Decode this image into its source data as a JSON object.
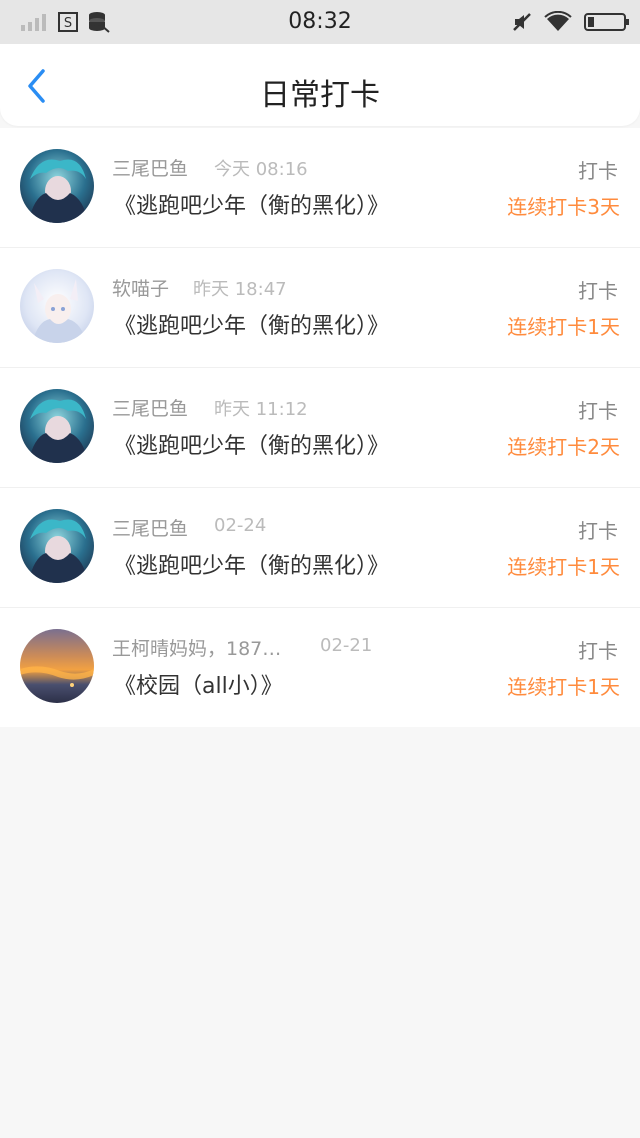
{
  "status_bar": {
    "time": "08:32",
    "signal_icon": "signal-bars-icon",
    "sim_icon": "sim-s-icon",
    "data_icon": "data-saver-icon",
    "mute_icon": "mute-icon",
    "wifi_icon": "wifi-icon",
    "battery_icon": "battery-icon"
  },
  "header": {
    "title": "日常打卡",
    "back_icon": "chevron-left-icon",
    "accent": "#2a8df3"
  },
  "colors": {
    "streak": "#ff8b3d",
    "background": "#f7f7f7"
  },
  "records": [
    {
      "name": "三尾巴鱼",
      "time": "今天 08:16",
      "book": "《逃跑吧少年（衡的黑化）》",
      "tag": "打卡",
      "streak": "连续打卡3天"
    },
    {
      "name": "软喵子",
      "time": "昨天 18:47",
      "book": "《逃跑吧少年（衡的黑化）》",
      "tag": "打卡",
      "streak": "连续打卡1天"
    },
    {
      "name": "三尾巴鱼",
      "time": "昨天 11:12",
      "book": "《逃跑吧少年（衡的黑化）》",
      "tag": "打卡",
      "streak": "连续打卡2天"
    },
    {
      "name": "三尾巴鱼",
      "time": "02-24",
      "book": "《逃跑吧少年（衡的黑化）》",
      "tag": "打卡",
      "streak": "连续打卡1天"
    },
    {
      "name": "王柯晴妈妈，187…",
      "time": "02-21",
      "book": "《校园（all小）》",
      "tag": "打卡",
      "streak": "连续打卡1天"
    }
  ]
}
